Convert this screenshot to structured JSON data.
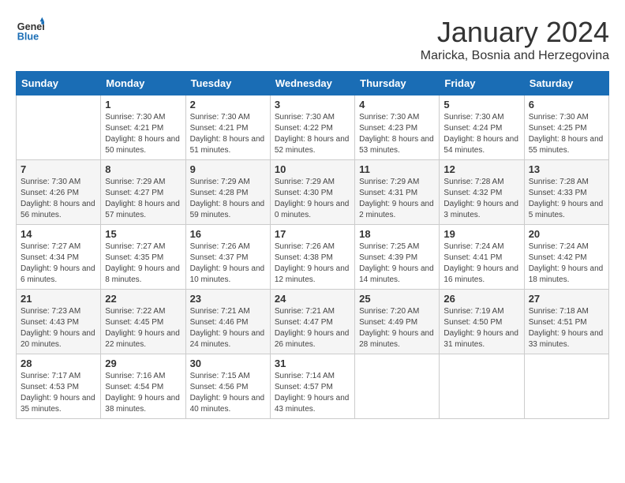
{
  "header": {
    "logo_general": "General",
    "logo_blue": "Blue",
    "month_year": "January 2024",
    "location": "Maricka, Bosnia and Herzegovina"
  },
  "weekdays": [
    "Sunday",
    "Monday",
    "Tuesday",
    "Wednesday",
    "Thursday",
    "Friday",
    "Saturday"
  ],
  "weeks": [
    [
      {
        "day": "",
        "sunrise": "",
        "sunset": "",
        "daylight": ""
      },
      {
        "day": "1",
        "sunrise": "Sunrise: 7:30 AM",
        "sunset": "Sunset: 4:21 PM",
        "daylight": "Daylight: 8 hours and 50 minutes."
      },
      {
        "day": "2",
        "sunrise": "Sunrise: 7:30 AM",
        "sunset": "Sunset: 4:21 PM",
        "daylight": "Daylight: 8 hours and 51 minutes."
      },
      {
        "day": "3",
        "sunrise": "Sunrise: 7:30 AM",
        "sunset": "Sunset: 4:22 PM",
        "daylight": "Daylight: 8 hours and 52 minutes."
      },
      {
        "day": "4",
        "sunrise": "Sunrise: 7:30 AM",
        "sunset": "Sunset: 4:23 PM",
        "daylight": "Daylight: 8 hours and 53 minutes."
      },
      {
        "day": "5",
        "sunrise": "Sunrise: 7:30 AM",
        "sunset": "Sunset: 4:24 PM",
        "daylight": "Daylight: 8 hours and 54 minutes."
      },
      {
        "day": "6",
        "sunrise": "Sunrise: 7:30 AM",
        "sunset": "Sunset: 4:25 PM",
        "daylight": "Daylight: 8 hours and 55 minutes."
      }
    ],
    [
      {
        "day": "7",
        "sunrise": "Sunrise: 7:30 AM",
        "sunset": "Sunset: 4:26 PM",
        "daylight": "Daylight: 8 hours and 56 minutes."
      },
      {
        "day": "8",
        "sunrise": "Sunrise: 7:29 AM",
        "sunset": "Sunset: 4:27 PM",
        "daylight": "Daylight: 8 hours and 57 minutes."
      },
      {
        "day": "9",
        "sunrise": "Sunrise: 7:29 AM",
        "sunset": "Sunset: 4:28 PM",
        "daylight": "Daylight: 8 hours and 59 minutes."
      },
      {
        "day": "10",
        "sunrise": "Sunrise: 7:29 AM",
        "sunset": "Sunset: 4:30 PM",
        "daylight": "Daylight: 9 hours and 0 minutes."
      },
      {
        "day": "11",
        "sunrise": "Sunrise: 7:29 AM",
        "sunset": "Sunset: 4:31 PM",
        "daylight": "Daylight: 9 hours and 2 minutes."
      },
      {
        "day": "12",
        "sunrise": "Sunrise: 7:28 AM",
        "sunset": "Sunset: 4:32 PM",
        "daylight": "Daylight: 9 hours and 3 minutes."
      },
      {
        "day": "13",
        "sunrise": "Sunrise: 7:28 AM",
        "sunset": "Sunset: 4:33 PM",
        "daylight": "Daylight: 9 hours and 5 minutes."
      }
    ],
    [
      {
        "day": "14",
        "sunrise": "Sunrise: 7:27 AM",
        "sunset": "Sunset: 4:34 PM",
        "daylight": "Daylight: 9 hours and 6 minutes."
      },
      {
        "day": "15",
        "sunrise": "Sunrise: 7:27 AM",
        "sunset": "Sunset: 4:35 PM",
        "daylight": "Daylight: 9 hours and 8 minutes."
      },
      {
        "day": "16",
        "sunrise": "Sunrise: 7:26 AM",
        "sunset": "Sunset: 4:37 PM",
        "daylight": "Daylight: 9 hours and 10 minutes."
      },
      {
        "day": "17",
        "sunrise": "Sunrise: 7:26 AM",
        "sunset": "Sunset: 4:38 PM",
        "daylight": "Daylight: 9 hours and 12 minutes."
      },
      {
        "day": "18",
        "sunrise": "Sunrise: 7:25 AM",
        "sunset": "Sunset: 4:39 PM",
        "daylight": "Daylight: 9 hours and 14 minutes."
      },
      {
        "day": "19",
        "sunrise": "Sunrise: 7:24 AM",
        "sunset": "Sunset: 4:41 PM",
        "daylight": "Daylight: 9 hours and 16 minutes."
      },
      {
        "day": "20",
        "sunrise": "Sunrise: 7:24 AM",
        "sunset": "Sunset: 4:42 PM",
        "daylight": "Daylight: 9 hours and 18 minutes."
      }
    ],
    [
      {
        "day": "21",
        "sunrise": "Sunrise: 7:23 AM",
        "sunset": "Sunset: 4:43 PM",
        "daylight": "Daylight: 9 hours and 20 minutes."
      },
      {
        "day": "22",
        "sunrise": "Sunrise: 7:22 AM",
        "sunset": "Sunset: 4:45 PM",
        "daylight": "Daylight: 9 hours and 22 minutes."
      },
      {
        "day": "23",
        "sunrise": "Sunrise: 7:21 AM",
        "sunset": "Sunset: 4:46 PM",
        "daylight": "Daylight: 9 hours and 24 minutes."
      },
      {
        "day": "24",
        "sunrise": "Sunrise: 7:21 AM",
        "sunset": "Sunset: 4:47 PM",
        "daylight": "Daylight: 9 hours and 26 minutes."
      },
      {
        "day": "25",
        "sunrise": "Sunrise: 7:20 AM",
        "sunset": "Sunset: 4:49 PM",
        "daylight": "Daylight: 9 hours and 28 minutes."
      },
      {
        "day": "26",
        "sunrise": "Sunrise: 7:19 AM",
        "sunset": "Sunset: 4:50 PM",
        "daylight": "Daylight: 9 hours and 31 minutes."
      },
      {
        "day": "27",
        "sunrise": "Sunrise: 7:18 AM",
        "sunset": "Sunset: 4:51 PM",
        "daylight": "Daylight: 9 hours and 33 minutes."
      }
    ],
    [
      {
        "day": "28",
        "sunrise": "Sunrise: 7:17 AM",
        "sunset": "Sunset: 4:53 PM",
        "daylight": "Daylight: 9 hours and 35 minutes."
      },
      {
        "day": "29",
        "sunrise": "Sunrise: 7:16 AM",
        "sunset": "Sunset: 4:54 PM",
        "daylight": "Daylight: 9 hours and 38 minutes."
      },
      {
        "day": "30",
        "sunrise": "Sunrise: 7:15 AM",
        "sunset": "Sunset: 4:56 PM",
        "daylight": "Daylight: 9 hours and 40 minutes."
      },
      {
        "day": "31",
        "sunrise": "Sunrise: 7:14 AM",
        "sunset": "Sunset: 4:57 PM",
        "daylight": "Daylight: 9 hours and 43 minutes."
      },
      {
        "day": "",
        "sunrise": "",
        "sunset": "",
        "daylight": ""
      },
      {
        "day": "",
        "sunrise": "",
        "sunset": "",
        "daylight": ""
      },
      {
        "day": "",
        "sunrise": "",
        "sunset": "",
        "daylight": ""
      }
    ]
  ]
}
